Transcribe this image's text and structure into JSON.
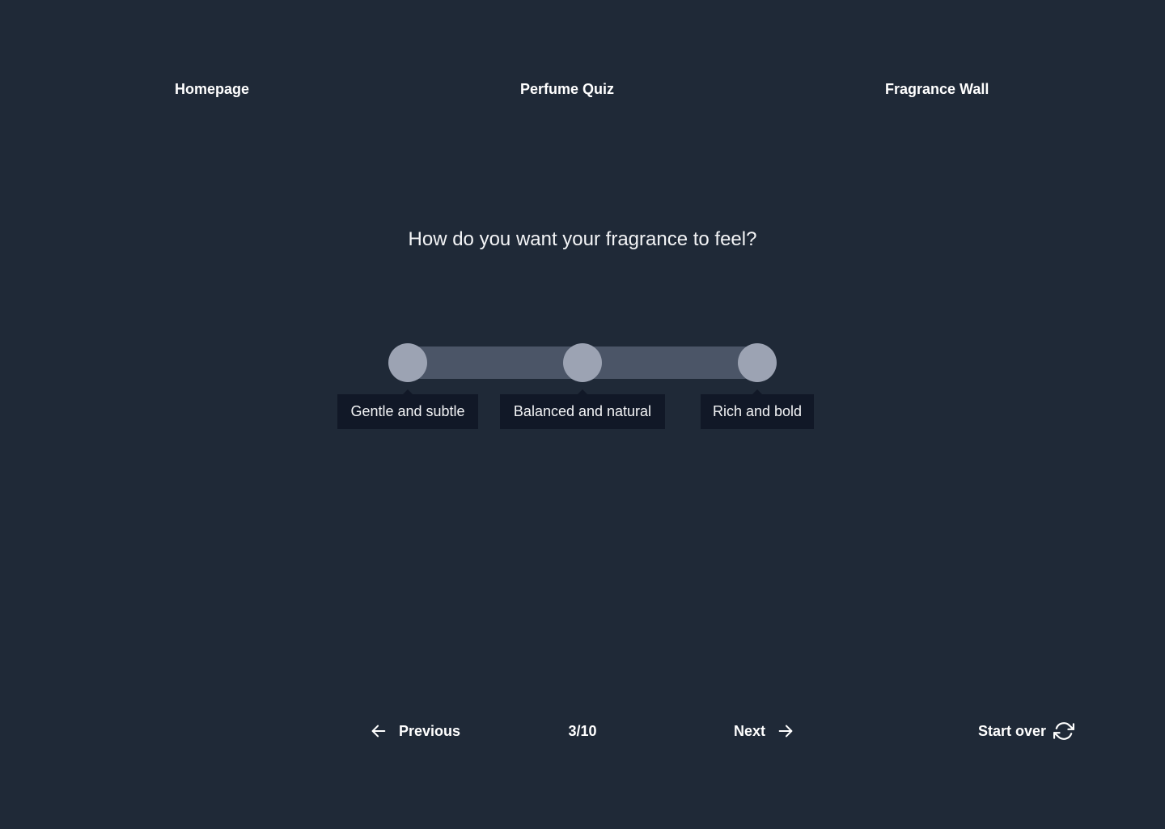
{
  "nav": {
    "homepage": "Homepage",
    "quiz": "Perfume Quiz",
    "wall": "Fragrance Wall"
  },
  "question": "How do you want your fragrance to feel?",
  "slider": {
    "options": [
      {
        "label": "Gentle and subtle"
      },
      {
        "label": "Balanced and natural"
      },
      {
        "label": "Rich and bold"
      }
    ]
  },
  "footer": {
    "previous": "Previous",
    "counter": "3/10",
    "next": "Next",
    "start_over": "Start over"
  },
  "icons": {
    "previous": "arrow-left-icon",
    "next": "arrow-right-icon",
    "start_over": "refresh-icon"
  },
  "colors": {
    "background": "#1f2937",
    "track": "#4b5567",
    "knob": "#9ca3b3",
    "tooltip": "#111827"
  }
}
